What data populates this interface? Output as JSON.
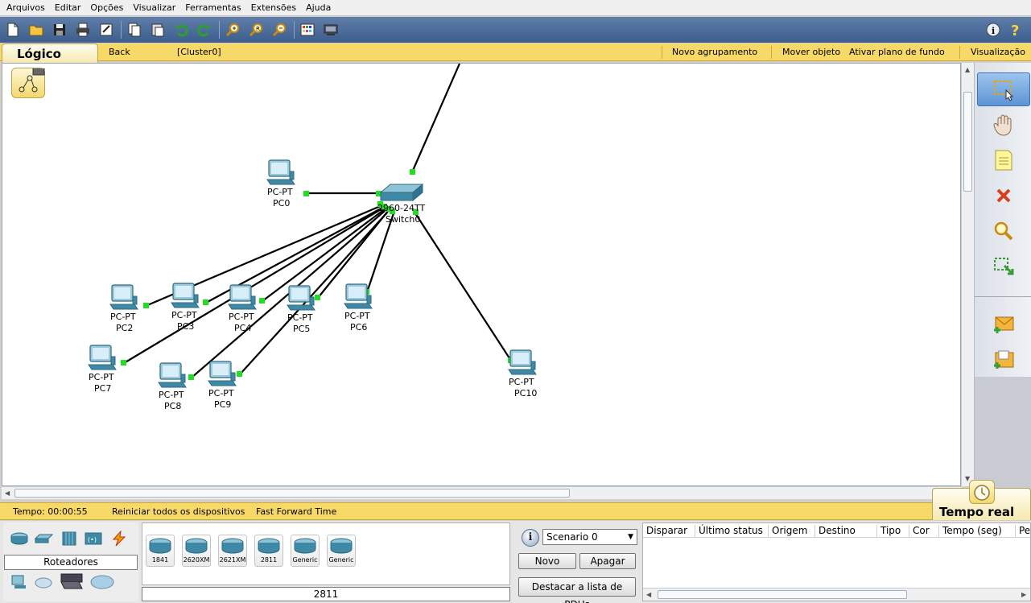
{
  "menu": [
    "Arquivos",
    "Editar",
    "Opções",
    "Visualizar",
    "Ferramentas",
    "Extensões",
    "Ajuda"
  ],
  "toolbar": {
    "icons": [
      "new-file-icon",
      "open-folder-icon",
      "save-icon",
      "print-icon",
      "activity-wizard-icon",
      "copy-icon",
      "paste-icon",
      "undo-icon",
      "redo-icon",
      "zoom-in-icon",
      "zoom-reset-icon",
      "zoom-out-icon",
      "palette-icon",
      "custom-device-icon"
    ],
    "right_icons": [
      "info-icon",
      "help-icon"
    ]
  },
  "logical_bar": {
    "tab_label": "Lógico",
    "back": "Back",
    "cluster": "[Cluster0]",
    "new_cluster": "Novo agrupamento",
    "move_object": "Mover objeto",
    "set_background": "Ativar plano de fundo",
    "viewport": "Visualização"
  },
  "topology": {
    "switch": {
      "model": "2960-24TT",
      "name": "Switch0"
    },
    "pcs": [
      {
        "model": "PC-PT",
        "name": "PC0"
      },
      {
        "model": "PC-PT",
        "name": "PC2"
      },
      {
        "model": "PC-PT",
        "name": "PC3"
      },
      {
        "model": "PC-PT",
        "name": "PC4"
      },
      {
        "model": "PC-PT",
        "name": "PC5"
      },
      {
        "model": "PC-PT",
        "name": "PC6"
      },
      {
        "model": "PC-PT",
        "name": "PC7"
      },
      {
        "model": "PC-PT",
        "name": "PC8"
      },
      {
        "model": "PC-PT",
        "name": "PC9"
      },
      {
        "model": "PC-PT",
        "name": "PC10"
      }
    ],
    "link_color": "#000000",
    "port_up_color": "#22dd22"
  },
  "right_palette": [
    "select-tool-icon",
    "move-hand-icon",
    "note-icon",
    "delete-icon",
    "inspect-icon",
    "resize-shape-icon",
    "add-simple-pdu-icon",
    "add-complex-pdu-icon"
  ],
  "time_bar": {
    "time": "Tempo: 00:00:55",
    "power_cycle": "Reiniciar todos os dispositivos",
    "fast_forward": "Fast Forward Time",
    "realtime_tab": "Tempo real"
  },
  "device_panel": {
    "category_label": "Roteadores",
    "category_icons": [
      "router-icon",
      "switch-icon",
      "hub-icon",
      "wireless-icon",
      "connection-icon",
      "end-device-icon",
      "wan-cloud-icon",
      "custom-device-icon",
      "multiuser-icon"
    ],
    "models": [
      "1841",
      "2620XM",
      "2621XM",
      "2811",
      "Generic",
      "Generic"
    ],
    "selected_model": "2811"
  },
  "scenario": {
    "selected": "Scenario 0",
    "new_button": "Novo",
    "delete_button": "Apagar",
    "toggle_pdu_list": "Destacar a lista de PDUs"
  },
  "pdu_table": {
    "columns": [
      "Disparar",
      "Último status",
      "Origem",
      "Destino",
      "Tipo",
      "Cor",
      "Tempo (seg)",
      "Pe"
    ]
  }
}
